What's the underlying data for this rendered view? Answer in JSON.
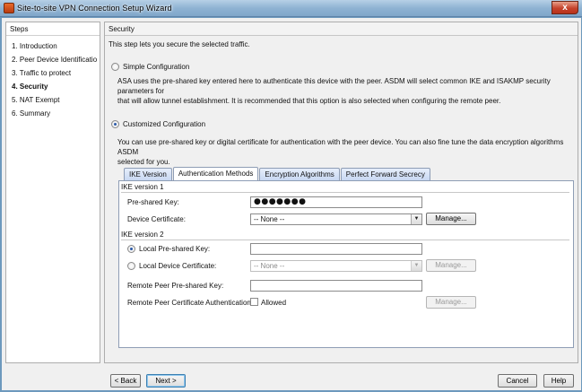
{
  "window": {
    "title": "Site-to-site VPN Connection Setup Wizard",
    "close_glyph": "x"
  },
  "steps": {
    "title": "Steps",
    "items": [
      {
        "label": "1. Introduction",
        "active": false
      },
      {
        "label": "2. Peer Device Identificatio",
        "active": false
      },
      {
        "label": "3. Traffic to protect",
        "active": false
      },
      {
        "label": "4. Security",
        "active": true
      },
      {
        "label": "5. NAT Exempt",
        "active": false
      },
      {
        "label": "6. Summary",
        "active": false
      }
    ]
  },
  "content": {
    "section_title": "Security",
    "intro": "This step lets you secure the selected traffic.",
    "simple": {
      "label": "Simple Configuration",
      "selected": false,
      "description_line1": "ASA uses the pre-shared key entered here to authenticate this device with the peer. ASDM will select common IKE and ISAKMP security parameters for",
      "description_line2": "that will allow tunnel establishment. It is recommended that this option is also selected when configuring the remote peer."
    },
    "custom": {
      "label": "Customized Configuration",
      "selected": true,
      "description_line1": "You can use pre-shared key or digital certificate for authentication with the peer device. You can also fine tune the data encryption algorithms ASDM",
      "description_line2": "selected for you."
    },
    "tabs": [
      {
        "label": "IKE Version",
        "active": false
      },
      {
        "label": "Authentication Methods",
        "active": true
      },
      {
        "label": "Encryption Algorithms",
        "active": false
      },
      {
        "label": "Perfect Forward Secrecy",
        "active": false
      }
    ],
    "ike_v1": {
      "group_label": "IKE version 1",
      "psk_label": "Pre-shared Key:",
      "psk_value": "●●●●●●●",
      "cert_label": "Device Certificate:",
      "cert_value": "-- None --",
      "manage_label": "Manage..."
    },
    "ike_v2": {
      "group_label": "IKE version 2",
      "local_psk_label": "Local Pre-shared Key:",
      "local_psk_selected": true,
      "local_psk_value": "",
      "local_cert_label": "Local Device Certificate:",
      "local_cert_selected": false,
      "local_cert_value": "-- None --",
      "manage_label": "Manage...",
      "remote_psk_label": "Remote Peer Pre-shared Key:",
      "remote_psk_value": "",
      "remote_cert_label": "Remote Peer Certificate Authentication:",
      "allowed_label": "Allowed",
      "allowed_checked": false,
      "remote_manage_label": "Manage..."
    }
  },
  "footer": {
    "back_label": "< Back",
    "next_label": "Next >",
    "cancel_label": "Cancel",
    "help_label": "Help"
  }
}
